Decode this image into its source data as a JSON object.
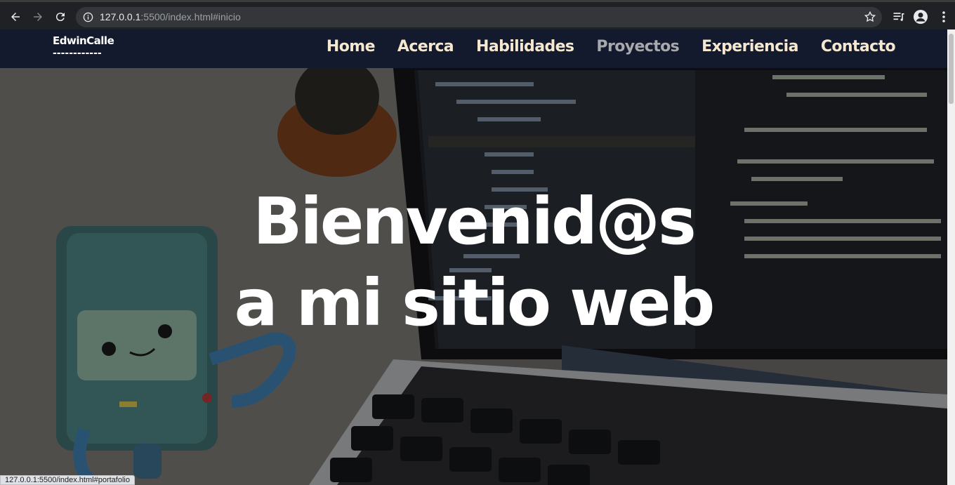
{
  "browser": {
    "url_host": "127.0.0.1",
    "url_rest": ":5500/index.html#inicio",
    "status_url": "127.0.0.1:5500/index.html#portafolio"
  },
  "site": {
    "logo": "EdwinCalle",
    "logo_underline": "------------",
    "nav": [
      {
        "label": "Home"
      },
      {
        "label": "Acerca"
      },
      {
        "label": "Habilidades"
      },
      {
        "label": "Proyectos"
      },
      {
        "label": "Experiencia"
      },
      {
        "label": "Contacto"
      }
    ]
  },
  "hero": {
    "line1": "Bienvenid@s",
    "line2": "a mi sitio web"
  },
  "colors": {
    "header_bg": "#141a2d",
    "nav_text": "#f6e8cf",
    "nav_active": "#a9a9ad"
  },
  "icons": [
    "back-icon",
    "forward-icon",
    "reload-icon",
    "info-icon",
    "star-icon",
    "reading-list-icon",
    "profile-icon",
    "menu-dots-icon"
  ]
}
